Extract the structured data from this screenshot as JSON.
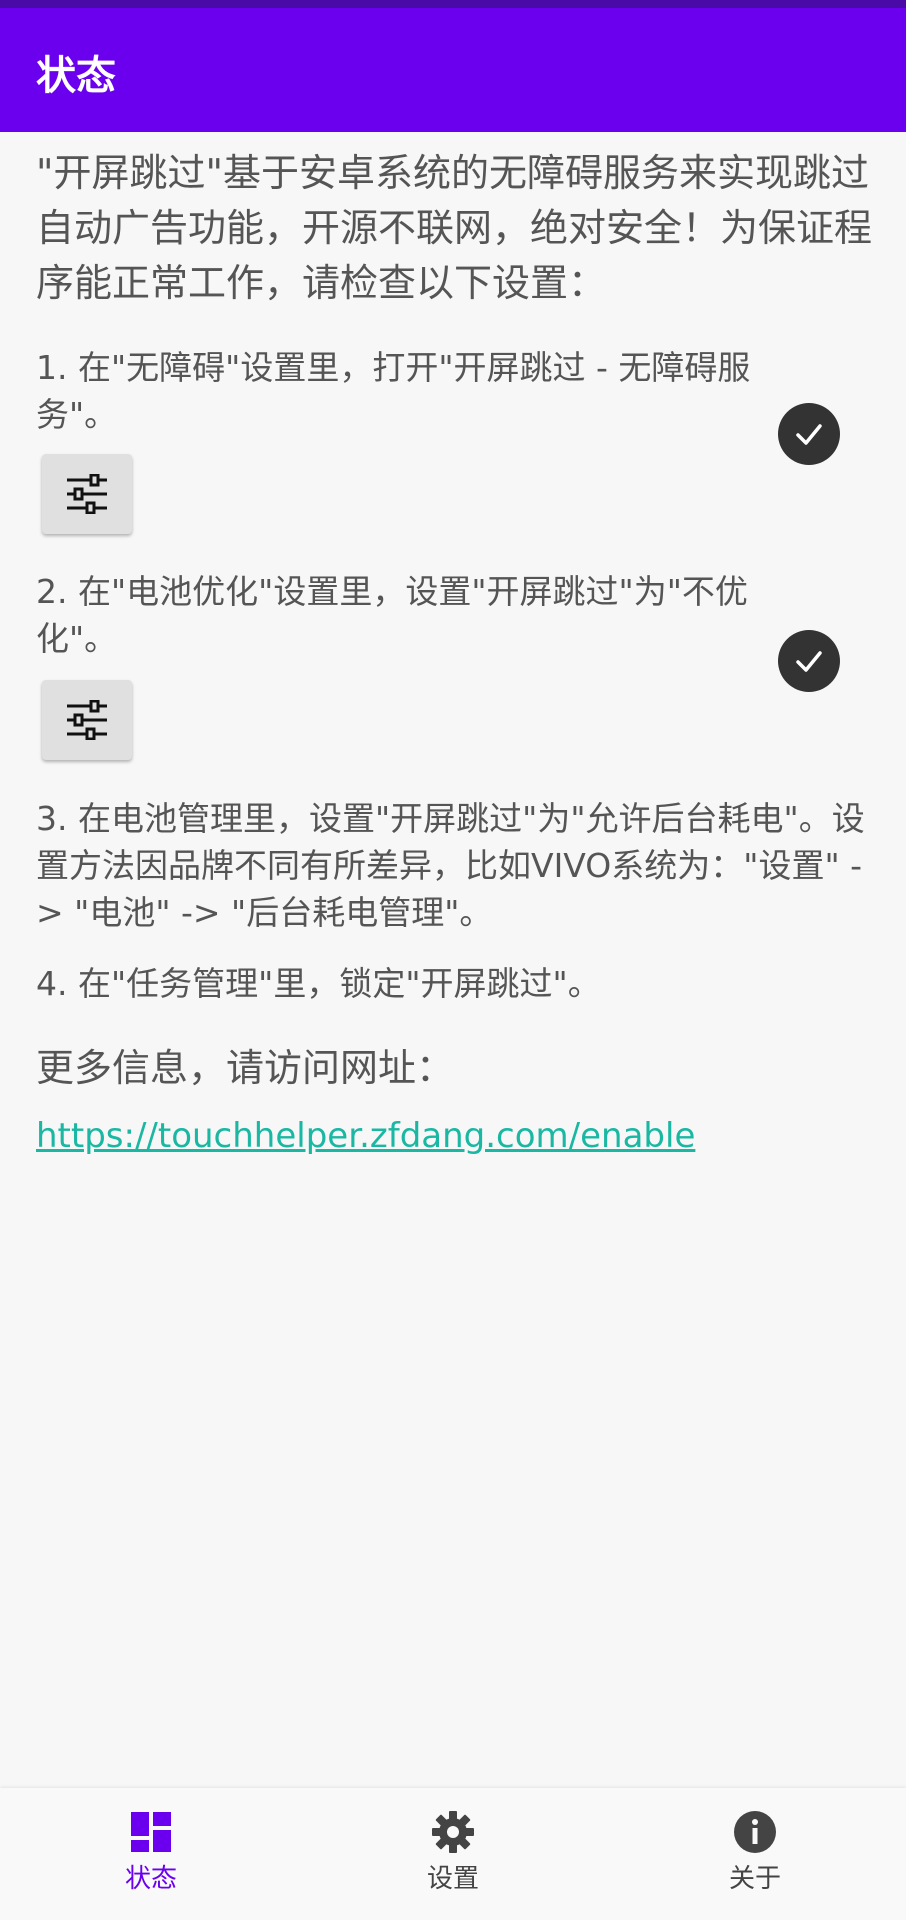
{
  "colors": {
    "primary": "#6a00ee",
    "status_bar": "#4a0aa8",
    "link": "#1ab8a3",
    "check": "#333333"
  },
  "appbar": {
    "title": "状态"
  },
  "intro": "\"开屏跳过\"基于安卓系统的无障碍服务来实现跳过自动广告功能，开源不联网，绝对安全！为保证程序能正常工作，请检查以下设置：",
  "steps": [
    {
      "text": "1. 在\"无障碍\"设置里，打开\"开屏跳过 - 无障碍服务\"。",
      "button_icon": "sliders-icon",
      "status_icon": "check-circle-icon"
    },
    {
      "text": "2. 在\"电池优化\"设置里，设置\"开屏跳过\"为\"不优化\"。",
      "button_icon": "sliders-icon",
      "status_icon": "check-circle-icon"
    },
    {
      "text": "3. 在电池管理里，设置\"开屏跳过\"为\"允许后台耗电\"。设置方法因品牌不同有所差异，比如VIVO系统为：\"设置\" -> \"电池\" -> \"后台耗电管理\"。"
    },
    {
      "text": "4. 在\"任务管理\"里，锁定\"开屏跳过\"。"
    }
  ],
  "more_info": {
    "label": "更多信息，请访问网址：",
    "url": "https://touchhelper.zfdang.com/enable"
  },
  "bottom_nav": [
    {
      "label": "状态",
      "icon": "dashboard-icon",
      "active": true
    },
    {
      "label": "设置",
      "icon": "gear-icon",
      "active": false
    },
    {
      "label": "关于",
      "icon": "info-icon",
      "active": false
    }
  ]
}
